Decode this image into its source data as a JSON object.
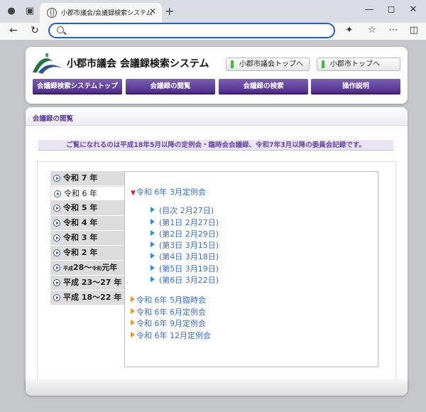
{
  "browser": {
    "tab_title": "小郡市議会/会議録検索システム",
    "url_value": "",
    "url_placeholder": ""
  },
  "header": {
    "title": "小郡市議会 会議録検索システム",
    "top_links": [
      "小郡市議会トップへ",
      "小郡市トップへ"
    ],
    "nav": [
      "会議録検索システムトップ",
      "会議録の閲覧",
      "会議録の検索",
      "操作説明"
    ]
  },
  "section": {
    "title": "会議録の閲覧",
    "notice": "ご覧になれるのは平成18年5月以降の定例会・臨時会会議録、令和7年3月以降の委員会記録です。"
  },
  "years": {
    "r7": "令和 7 年",
    "r6": "令和 6 年",
    "r5": "令和 5 年",
    "r4": "令和 4 年",
    "r3": "令和 3 年",
    "r2": "令和 2 年",
    "h28_pre": "平成",
    "h28_mid": "28～",
    "h28_reiwa": "令和",
    "h28_post": "元年",
    "h23": "平成 23～27 年",
    "h18": "平成 18～22 年"
  },
  "meetings": {
    "open": "令和 6年 3月定例会",
    "days": [
      "(目次 2月27日)",
      "(第1日 2月27日)",
      "(第2日 2月29日)",
      "(第3日 3月15日)",
      "(第4日 3月18日)",
      "(第5日 3月19日)",
      "(第6日 3月22日)"
    ],
    "others": [
      "令和 6年 5月臨時会",
      "令和 6年 6月定例会",
      "令和 6年 9月定例会",
      "令和 6年 12月定例会"
    ]
  },
  "colors": {
    "accent_purple": "#4e2d8a",
    "link_blue": "#3a6fd0",
    "bullet_orange": "#f0951c",
    "bullet_red": "#e0201c",
    "bullet_blue": "#2a8ce8"
  }
}
